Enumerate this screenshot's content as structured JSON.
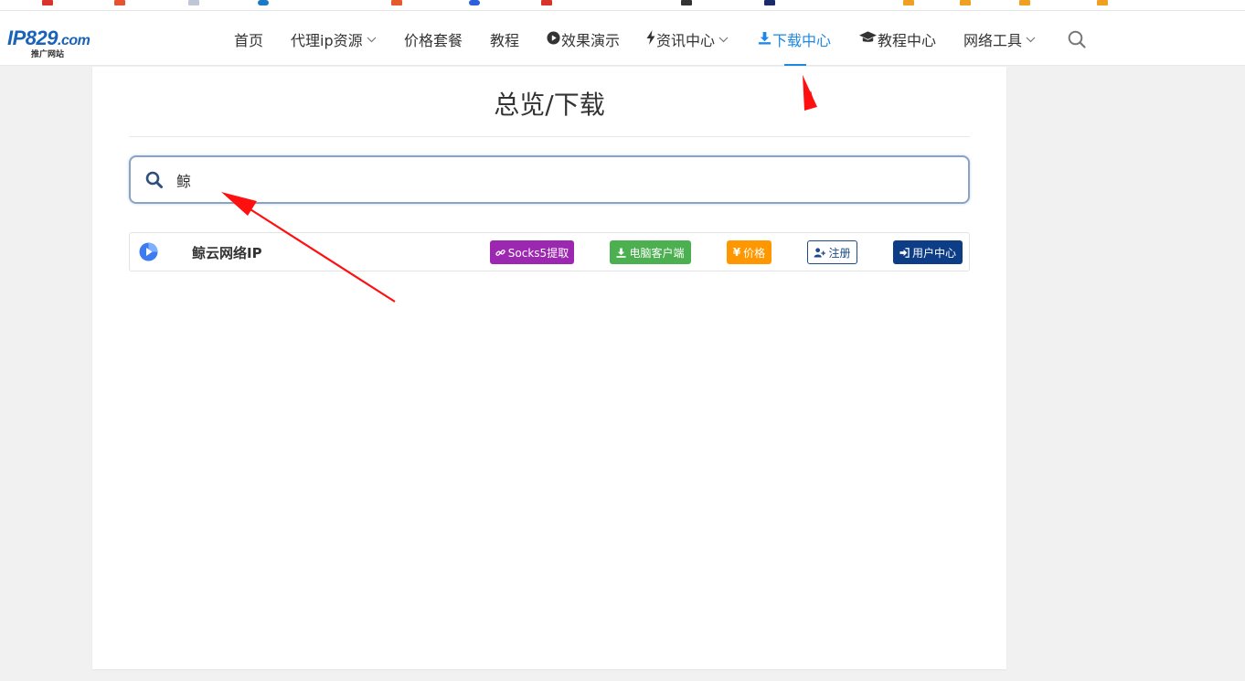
{
  "logo": {
    "main": "IP829",
    "suffix": ".com",
    "sub": "推广网站"
  },
  "nav": {
    "items": [
      {
        "label": "首页",
        "icon": "",
        "has_dropdown": false
      },
      {
        "label": "代理ip资源",
        "icon": "",
        "has_dropdown": true
      },
      {
        "label": "价格套餐",
        "icon": "",
        "has_dropdown": false
      },
      {
        "label": "教程",
        "icon": "",
        "has_dropdown": false
      },
      {
        "label": "效果演示",
        "icon": "play-circle-icon",
        "has_dropdown": false
      },
      {
        "label": "资讯中心",
        "icon": "bolt-icon",
        "has_dropdown": true
      },
      {
        "label": "下载中心",
        "icon": "download-icon",
        "has_dropdown": false,
        "active": true
      },
      {
        "label": "教程中心",
        "icon": "graduation-cap-icon",
        "has_dropdown": false
      },
      {
        "label": "网络工具",
        "icon": "",
        "has_dropdown": true
      }
    ],
    "search_icon": "search-icon"
  },
  "page": {
    "title": "总览/下载",
    "search": {
      "value": "鲸",
      "icon": "search-icon"
    }
  },
  "results": [
    {
      "name": "鲸云网络IP",
      "icon": "provider-logo-icon",
      "buttons": {
        "socks": "Socks5提取",
        "client": "电脑客户端",
        "price": "价格",
        "register": "注册",
        "user_center": "用户中心"
      }
    }
  ],
  "colors": {
    "accent": "#1e88e5",
    "socks": "#9c27b0",
    "client": "#4caf50",
    "price": "#ff9800",
    "register": "#1a4a8a",
    "user_center": "#0d3d87",
    "annotation": "#ff0000"
  }
}
